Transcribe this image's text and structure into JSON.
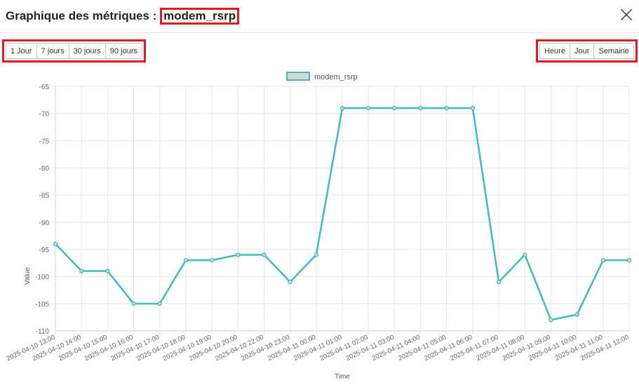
{
  "header": {
    "title_prefix": "Graphique des métriques :",
    "metric_name": "modem_rsrp"
  },
  "range_buttons": [
    "1 Jour",
    "7 jours",
    "30 jours",
    "90 jours"
  ],
  "unit_buttons": [
    "Heure",
    "Jour",
    "Semaine"
  ],
  "colors": {
    "line": "#3dbdb7",
    "legend_fill": "#d6d6d6",
    "highlight": "#e01b24"
  },
  "chart_data": {
    "type": "line",
    "xlabel": "Time",
    "ylabel": "Value",
    "ylim": [
      -110,
      -65
    ],
    "yticks": [
      -65,
      -70,
      -75,
      -80,
      -85,
      -90,
      -95,
      -100,
      -105,
      -110
    ],
    "grid": true,
    "legend_position": "top-center",
    "categories": [
      "2025-04-10 13:00",
      "2025-04-10 14:00",
      "2025-04-10 15:00",
      "2025-04-10 16:00",
      "2025-04-10 17:00",
      "2025-04-10 18:00",
      "2025-04-10 19:00",
      "2025-04-10 20:00",
      "2025-04-10 22:00",
      "2025-04-10 23:00",
      "2025-04-11 00:00",
      "2025-04-11 01:00",
      "2025-04-11 02:00",
      "2025-04-11 03:00",
      "2025-04-11 04:00",
      "2025-04-11 05:00",
      "2025-04-11 06:00",
      "2025-04-11 07:00",
      "2025-04-11 08:00",
      "2025-04-11 09:00",
      "2025-04-11 10:00",
      "2025-04-11 11:00",
      "2025-04-11 12:00"
    ],
    "series": [
      {
        "name": "modem_rsrp",
        "values": [
          -94,
          -99,
          -99,
          -105,
          -105,
          -97,
          -97,
          -96,
          -96,
          -101,
          -96,
          -69,
          -69,
          -69,
          -69,
          -69,
          -69,
          -101,
          -96,
          -108,
          -107,
          -97,
          -97
        ]
      }
    ]
  }
}
